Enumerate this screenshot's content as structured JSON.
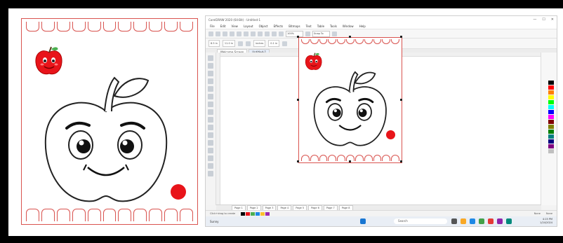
{
  "app": {
    "title": "CorelDRAW 2020 (64-Bit) - Untitled-1",
    "window_controls": [
      "—",
      "☐",
      "✕"
    ],
    "menu": [
      "File",
      "Edit",
      "View",
      "Layout",
      "Object",
      "Effects",
      "Bitmaps",
      "Text",
      "Table",
      "Tools",
      "Window",
      "Help"
    ],
    "toolbar": {
      "zoom": "100%",
      "snap": "Snap To"
    },
    "properties": {
      "width": "8.5 in",
      "height": "11.0 in",
      "units": "inches",
      "nudge": "0.1 in"
    },
    "tabs": [
      "Welcome Screen",
      "Untitled-1"
    ],
    "pages": [
      "Page 1",
      "Page 2",
      "Page 3",
      "Page 4",
      "Page 5",
      "Page 6",
      "Page 7",
      "Page 8"
    ],
    "status": {
      "left": "Click+drag to create",
      "fill": "None",
      "outline": "None"
    }
  },
  "taskbar": {
    "weather": "Sunny",
    "search_placeholder": "Search",
    "time": "4:15 PM",
    "date": "1/24/2024"
  },
  "colors": {
    "border_red": "#d9534f",
    "apple_red": "#e8141a",
    "palette": [
      "#000000",
      "#ffffff",
      "#ff0000",
      "#ff8000",
      "#ffff00",
      "#00ff00",
      "#00ffff",
      "#0000ff",
      "#ff00ff",
      "#800000",
      "#808000",
      "#008000",
      "#008080",
      "#000080",
      "#800080",
      "#c0c0c0"
    ]
  },
  "icons": [
    "apple-character-icon",
    "red-dot-decoration",
    "apple-outline-drawing"
  ]
}
